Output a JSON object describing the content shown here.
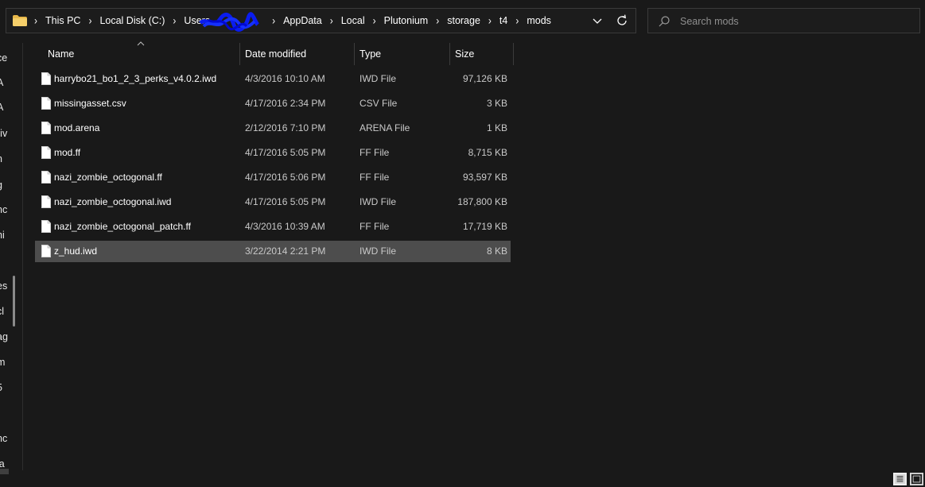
{
  "address_bar": {
    "crumbs": [
      "This PC",
      "Local Disk (C:)",
      "Users",
      "",
      "AppData",
      "Local",
      "Plutonium",
      "storage",
      "t4",
      "mods"
    ],
    "icons": [
      "folder-icon",
      "chevron-right-icon",
      "chevron-down-icon",
      "refresh-icon"
    ]
  },
  "search": {
    "placeholder": "Search mods",
    "value": "",
    "icon": "search-icon"
  },
  "nav_pane_fragments": [
    "ce",
    "A",
    "A",
    "riv",
    "n",
    "g",
    "nc",
    "hi",
    "es",
    "cl",
    "ag",
    "m",
    "5",
    "nc",
    "la"
  ],
  "columns": {
    "name": "Name",
    "date": "Date modified",
    "type": "Type",
    "size": "Size"
  },
  "files": [
    {
      "name": "harrybo21_bo1_2_3_perks_v4.0.2.iwd",
      "date": "4/3/2016 10:10 AM",
      "type": "IWD File",
      "size": "97,126 KB"
    },
    {
      "name": "missingasset.csv",
      "date": "4/17/2016 2:34 PM",
      "type": "CSV File",
      "size": "3 KB"
    },
    {
      "name": "mod.arena",
      "date": "2/12/2016 7:10 PM",
      "type": "ARENA File",
      "size": "1 KB"
    },
    {
      "name": "mod.ff",
      "date": "4/17/2016 5:05 PM",
      "type": "FF File",
      "size": "8,715 KB"
    },
    {
      "name": "nazi_zombie_octogonal.ff",
      "date": "4/17/2016 5:06 PM",
      "type": "FF File",
      "size": "93,597 KB"
    },
    {
      "name": "nazi_zombie_octogonal.iwd",
      "date": "4/17/2016 5:05 PM",
      "type": "IWD File",
      "size": "187,800 KB"
    },
    {
      "name": "nazi_zombie_octogonal_patch.ff",
      "date": "4/3/2016 10:39 AM",
      "type": "FF File",
      "size": "17,719 KB"
    },
    {
      "name": "z_hud.iwd",
      "date": "3/22/2014 2:21 PM",
      "type": "IWD File",
      "size": "8 KB"
    }
  ],
  "selected_file": "z_hud.iwd",
  "view_buttons": [
    "details-view-icon",
    "large-icons-view-icon"
  ],
  "colors": {
    "background": "#191919",
    "selection": "#4d4d4d",
    "text": "#ffffff",
    "secondary_text": "#c9c9c9",
    "folder": "#e8b84a",
    "scribble": "#0a1cf0"
  }
}
